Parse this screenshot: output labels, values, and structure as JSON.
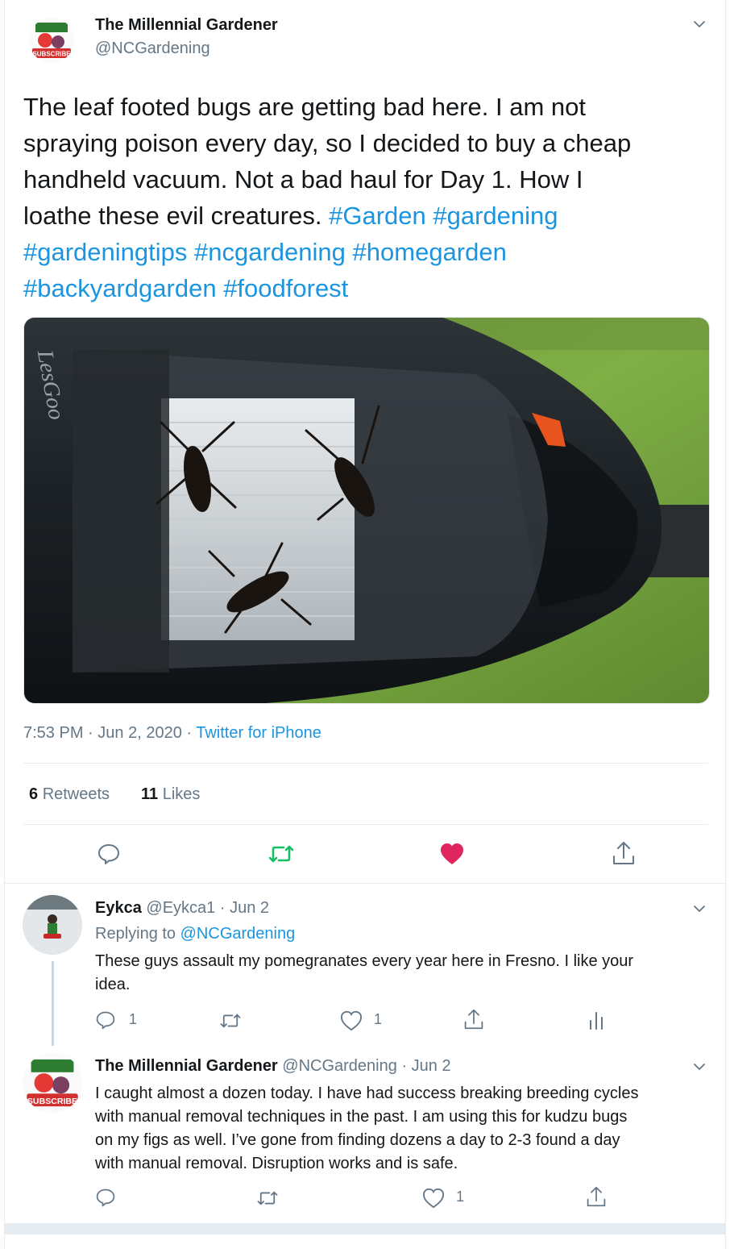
{
  "tweet": {
    "author_name": "The Millennial Gardener",
    "author_handle": "@NCGardening",
    "avatar_text": "SUBSCRIBE",
    "text_plain": "The leaf footed bugs are getting bad here. I am not spraying poison every day, so I decided to buy a cheap handheld vacuum. Not a bad haul for Day 1. How I loathe these evil creatures. ",
    "line1": "The leaf footed bugs are getting bad here. I am not",
    "line2": "spraying poison every day, so I decided to buy a cheap",
    "line3": "handheld vacuum. Not a bad haul for Day 1. How I",
    "line4_text": "loathe these evil creatures.",
    "hashtags": [
      "#Garden",
      "#gardening",
      "#gardeningtips",
      "#ncgardening",
      "#homegarden",
      "#backyardgarden",
      "#foodforest"
    ],
    "image_brand_text": "LesGoo",
    "time": "7:53 PM",
    "date": "Jun 2, 2020",
    "dot": "·",
    "source": "Twitter for iPhone",
    "retweets_count": "6",
    "retweets_label": "Retweets",
    "likes_count": "11",
    "likes_label": "Likes"
  },
  "replies": [
    {
      "name": "Eykca",
      "handle": "@Eykca1",
      "date": "· Jun 2",
      "replying_label": "Replying to",
      "replying_to": "@NCGardening",
      "line1": "These guys assault my pomegranates every year here in Fresno. I like your",
      "line2": "idea.",
      "reply_count": "1",
      "like_count": "1"
    },
    {
      "name": "The Millennial Gardener",
      "handle": "@NCGardening",
      "date": "· Jun 2",
      "line1": "I caught almost a dozen today. I have had success breaking breeding cycles",
      "line2": "with manual removal techniques in the past. I am using this for kudzu bugs",
      "line3": "on my figs as well. I’ve gone from finding dozens a day to 2-3 found a day",
      "line4": "with manual removal. Disruption works and is safe.",
      "like_count": "1"
    }
  ],
  "colors": {
    "accent": "#1b95e0",
    "retweet_green": "#17bf63",
    "like_red": "#e0245e",
    "muted": "#657786",
    "border": "#e6ecf0"
  },
  "icons": [
    "chevron-down-icon",
    "reply-icon",
    "retweet-icon",
    "heart-icon",
    "share-icon",
    "analytics-icon"
  ]
}
